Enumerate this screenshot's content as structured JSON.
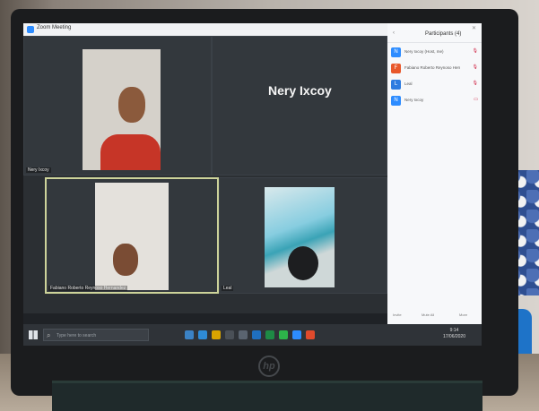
{
  "app": {
    "window_title": "Zoom Meeting"
  },
  "tiles": [
    {
      "label": "Nery Ixcoy"
    },
    {
      "label": "Nery Ixcoy"
    },
    {
      "label": "Fabiano Roberto Reynoso Hernandez"
    },
    {
      "label": "Leal"
    }
  ],
  "panel": {
    "title": "Participants (4)",
    "participants": [
      {
        "name": "Nery Ixcoy (Host, me)",
        "avatar_letter": "N",
        "color": "#2d8cff"
      },
      {
        "name": "Fabiano Roberto Reynoso Hernandez",
        "avatar_letter": "F",
        "color": "#e8582c"
      },
      {
        "name": "Leal",
        "avatar_letter": "L",
        "color": "#2d7be0"
      },
      {
        "name": "Nery Ixcoy",
        "avatar_letter": "N",
        "color": "#2d8cff"
      }
    ],
    "footer": {
      "invite": "Invite",
      "mute_all": "Mute All",
      "more": "More"
    }
  },
  "taskbar": {
    "search_placeholder": "Type here to search",
    "time": "9:14",
    "date": "17/06/2020"
  }
}
